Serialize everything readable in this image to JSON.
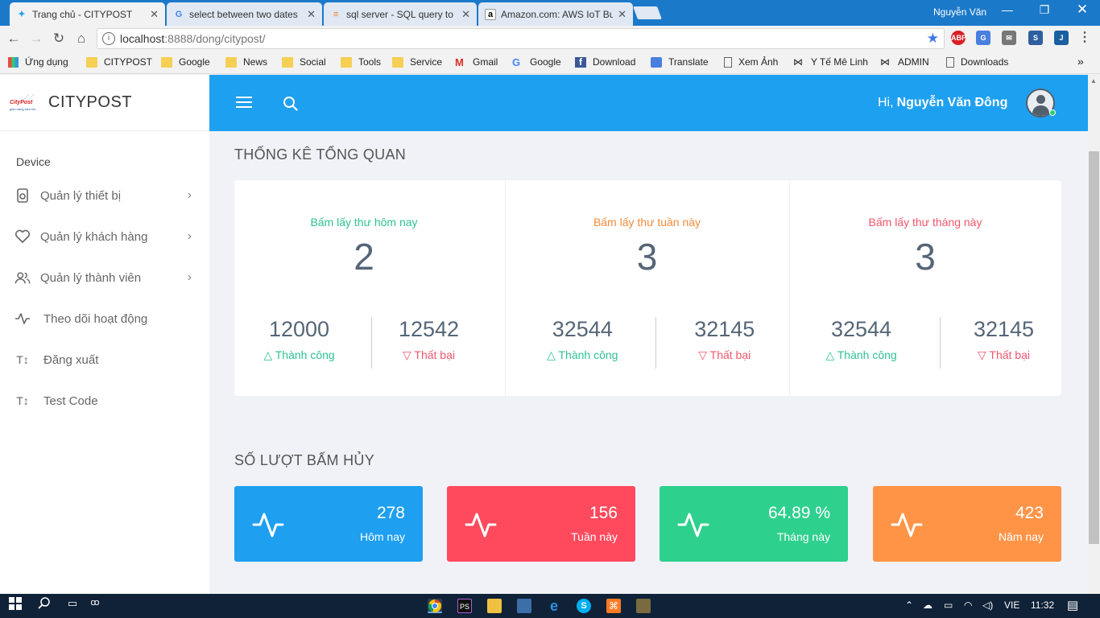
{
  "browser": {
    "tabs": [
      {
        "title": "Trang chủ - CITYPOST",
        "active": true
      },
      {
        "title": "select between two dates",
        "active": false
      },
      {
        "title": "sql server - SQL query to",
        "active": false
      },
      {
        "title": "Amazon.com: AWS IoT Bu",
        "active": false
      }
    ],
    "profile": "Nguyễn Văn",
    "url_host": "localhost",
    "url_rest": ":8888/dong/citypost/",
    "ext_abp": "ABP",
    "bookmarks": [
      "Ứng dụng",
      "CITYPOST",
      "Google",
      "News",
      "Social",
      "Tools",
      "Service",
      "Gmail",
      "Google",
      "Download",
      "Translate",
      "Xem Ảnh",
      "Y Tế Mê Linh",
      "ADMIN",
      "Downloads"
    ],
    "more": "»"
  },
  "sidebar": {
    "brand": "CITYPOST",
    "logo_text": "CityPost",
    "logo_sub": "giao hàng siêu tốc",
    "section": "Device",
    "items": [
      {
        "label": "Quản lý thiết bị",
        "icon": "device-icon",
        "has_children": true
      },
      {
        "label": "Quản lý khách hàng",
        "icon": "heart-icon",
        "has_children": true
      },
      {
        "label": "Quản lý thành viên",
        "icon": "users-icon",
        "has_children": true
      },
      {
        "label": "Theo dõi hoạt động",
        "icon": "activity-icon",
        "has_children": false
      },
      {
        "label": "Đăng xuất",
        "icon": "text-size-icon",
        "has_children": false
      },
      {
        "label": "Test Code",
        "icon": "text-size-icon",
        "has_children": false
      }
    ]
  },
  "header": {
    "greeting": "Hi,",
    "user": "Nguyễn Văn Đông"
  },
  "overview": {
    "title": "THỐNG KÊ TỔNG QUAN",
    "columns": [
      {
        "label": "Bấm lấy thư hôm nay",
        "value": "2",
        "success": "12000",
        "fail": "12542",
        "color": "#2ec293"
      },
      {
        "label": "Bấm lấy thư tuần này",
        "value": "3",
        "success": "32544",
        "fail": "32145",
        "color": "#f48a3c"
      },
      {
        "label": "Bấm lấy thư tháng này",
        "value": "3",
        "success": "32544",
        "fail": "32145",
        "color": "#f0566a"
      }
    ],
    "success_label": "Thành công",
    "fail_label": "Thất bại"
  },
  "cancel": {
    "title": "SỐ LƯỢT BẤM HỦY",
    "cards": [
      {
        "value": "278",
        "label": "Hôm nay",
        "color": "#1e9ff0"
      },
      {
        "value": "156",
        "label": "Tuần này",
        "color": "#ff4a5e"
      },
      {
        "value": "64.89 %",
        "label": "Tháng này",
        "color": "#2ed08d"
      },
      {
        "value": "423",
        "label": "Năm nay",
        "color": "#ff9447"
      }
    ]
  },
  "taskbar": {
    "lang": "VIE",
    "time": "11:32"
  }
}
